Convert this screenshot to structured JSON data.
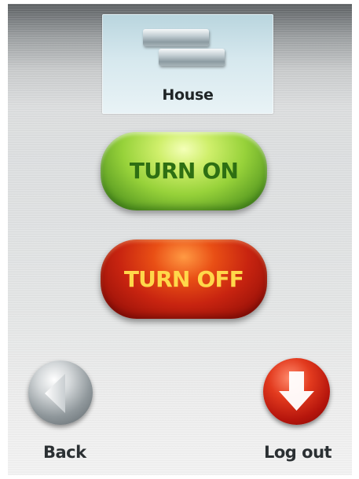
{
  "device_tile": {
    "label": "House",
    "icon": "house-icon"
  },
  "controls": {
    "turn_on_label": "TURN ON",
    "turn_off_label": "TURN OFF"
  },
  "navigation": {
    "back_label": "Back",
    "back_icon": "back-arrow-icon",
    "logout_label": "Log out",
    "logout_icon": "logout-arrow-icon"
  },
  "colors": {
    "on_accent": "#97d23a",
    "off_accent": "#c82410",
    "on_text": "#2e6f13",
    "off_text": "#ffd84a"
  }
}
